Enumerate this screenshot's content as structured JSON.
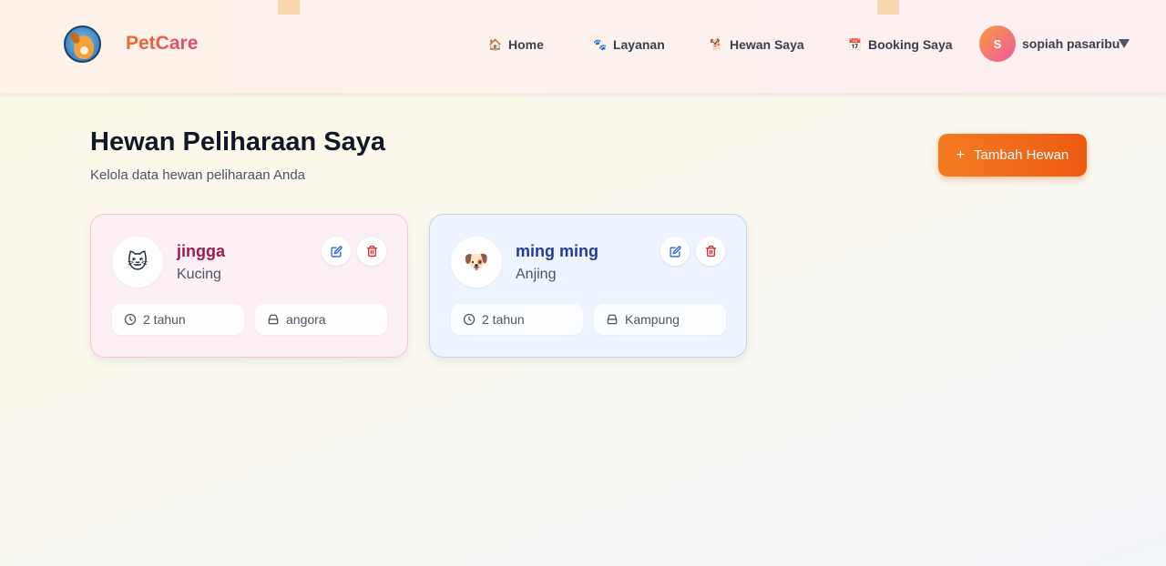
{
  "header": {
    "brand": "PetCare",
    "nav": [
      {
        "icon": "house-icon",
        "glyph": "🏠",
        "label": "Home"
      },
      {
        "icon": "paw-icon",
        "glyph": "🐾",
        "label": "Layanan"
      },
      {
        "icon": "dog-icon",
        "glyph": "🐕",
        "label": "Hewan Saya"
      },
      {
        "icon": "calendar-icon",
        "glyph": "📅",
        "label": "Booking Saya"
      }
    ],
    "user": {
      "initial": "S",
      "name": "sopiah pasaribu"
    }
  },
  "main": {
    "title": "Hewan Peliharaan Saya",
    "subtitle": "Kelola data hewan peliharaan Anda",
    "add_button": {
      "icon": "+",
      "label": "Tambah Hewan"
    },
    "pets": [
      {
        "emoji": "🐱",
        "name": "jingga",
        "species": "Kucing",
        "age": "2 tahun",
        "breed": "angora"
      },
      {
        "emoji": "🐶",
        "name": "ming ming",
        "species": "Anjing",
        "age": "2 tahun",
        "breed": "Kampung"
      }
    ]
  },
  "colors": {
    "accent": "#f06a1c",
    "brand_start": "#f2692a",
    "brand_end": "#e2477e",
    "cat_name": "#9d1a52",
    "dog_name": "#1e3f96",
    "edit_icon": "#2563eb",
    "delete_icon": "#dc2626"
  }
}
